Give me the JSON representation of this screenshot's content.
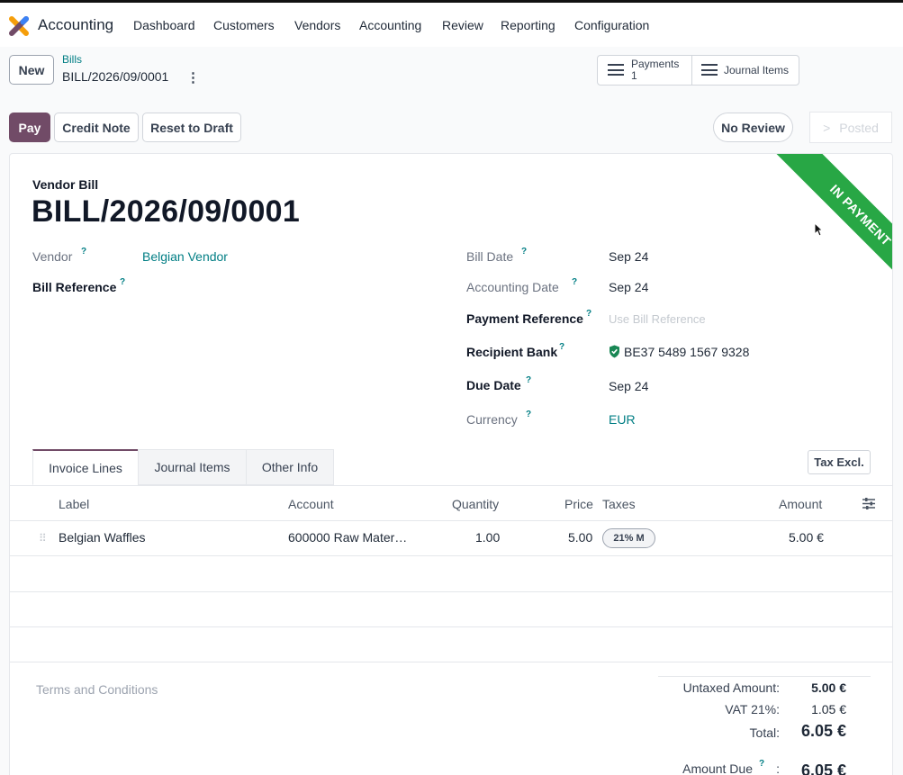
{
  "topbar": {
    "app_name": "Accounting",
    "menu": [
      "Dashboard",
      "Customers",
      "Vendors",
      "Accounting",
      "Review",
      "Reporting",
      "Configuration"
    ]
  },
  "control_panel": {
    "new_label": "New",
    "breadcrumb_parent": "Bills",
    "breadcrumb_current": "BILL/2026/09/0001",
    "more_icon": "⋮",
    "smart_buttons": {
      "payments_label": "Payments",
      "payments_count": "1",
      "journal_items_label": "Journal Items"
    }
  },
  "actions": {
    "pay": "Pay",
    "credit_note": "Credit Note",
    "reset_to_draft": "Reset to Draft",
    "no_review": "No Review",
    "posted": "Posted",
    "posted_arrow": ">"
  },
  "form": {
    "doc_type": "Vendor Bill",
    "doc_name": "BILL/2026/09/0001",
    "ribbon": "IN PAYMENT",
    "help_marker": "?",
    "left": {
      "vendor_label": "Vendor",
      "vendor_value": "Belgian Vendor",
      "bill_reference_label": "Bill Reference"
    },
    "right": {
      "bill_date_label": "Bill Date",
      "bill_date_value": "Sep 24",
      "accounting_date_label": "Accounting Date",
      "accounting_date_value": "Sep 24",
      "payment_reference_label": "Payment Reference",
      "payment_reference_placeholder": "Use Bill Reference",
      "recipient_bank_label": "Recipient Bank",
      "recipient_bank_value": "BE37 5489 1567 9328",
      "due_date_label": "Due Date",
      "due_date_value": "Sep 24",
      "currency_label": "Currency",
      "currency_value": "EUR"
    }
  },
  "tabs": [
    "Invoice Lines",
    "Journal Items",
    "Other Info"
  ],
  "tax_toggle": "Tax Excl.",
  "table": {
    "headers": [
      "Label",
      "Account",
      "Quantity",
      "Price",
      "Taxes",
      "Amount"
    ],
    "rows": [
      {
        "label": "Belgian Waffles",
        "account": "600000 Raw Mater…",
        "quantity": "1.00",
        "price": "5.00",
        "tax": "21% M",
        "amount": "5.00 €"
      }
    ]
  },
  "terms_placeholder": "Terms and Conditions",
  "totals": {
    "untaxed_label": "Untaxed Amount:",
    "untaxed_value": "5.00 €",
    "vat_label": "VAT 21%:",
    "vat_value": "1.05 €",
    "total_label": "Total:",
    "total_value": "6.05 €",
    "amount_due_label": "Amount Due",
    "amount_due_value": "6.05 €"
  },
  "colors": {
    "brand": "#714b67",
    "link": "#017e84",
    "ribbon": "#28a745"
  }
}
